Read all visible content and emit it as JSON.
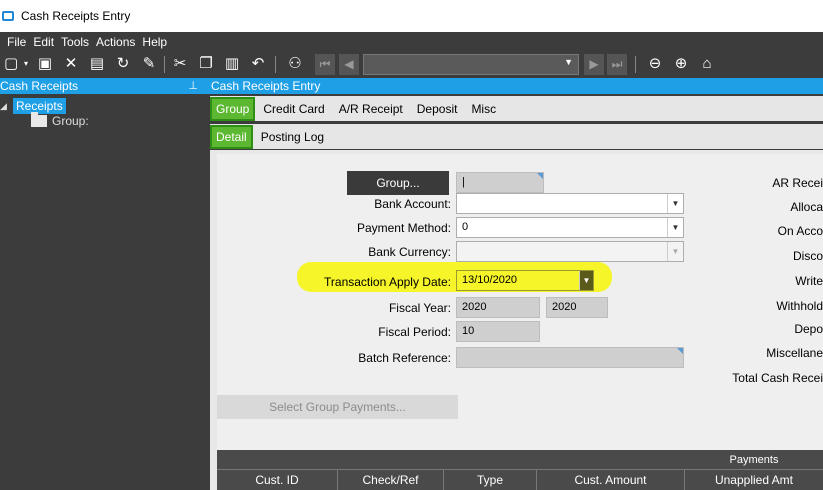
{
  "window": {
    "title": "Cash Receipts Entry"
  },
  "menu": [
    "File",
    "Edit",
    "Tools",
    "Actions",
    "Help"
  ],
  "toolbar": {
    "icons": [
      "new-icon",
      "save-icon",
      "delete-icon",
      "clipboard-icon",
      "refresh-icon",
      "clear-icon",
      "cut-icon",
      "copy-icon",
      "paste-icon",
      "undo-icon",
      "binoculars-icon",
      "first-icon",
      "prev-icon",
      "next-icon",
      "last-icon",
      "back-icon",
      "forward-icon",
      "home-icon"
    ]
  },
  "left_panel": {
    "title": "Cash Receipts",
    "tree": {
      "root": "Receipts",
      "child": "Group:"
    }
  },
  "main": {
    "title": "Cash Receipts Entry",
    "tabs": [
      "Group",
      "Credit Card",
      "A/R Receipt",
      "Deposit",
      "Misc"
    ],
    "subtabs": [
      "Detail",
      "Posting Log"
    ],
    "form": {
      "group_button": "Group...",
      "group_value": "|",
      "bank_account_label": "Bank Account:",
      "payment_method_label": "Payment Method:",
      "payment_method_value": "0",
      "bank_currency_label": "Bank Currency:",
      "transaction_apply_date_label": "Transaction Apply Date:",
      "transaction_apply_date_value": "13/10/2020",
      "fiscal_year_label": "Fiscal Year:",
      "fiscal_year_value": "2020",
      "fiscal_year_value2": "2020",
      "fiscal_period_label": "Fiscal Period:",
      "fiscal_period_value": "10",
      "batch_reference_label": "Batch Reference:",
      "select_group_payments": "Select Group Payments..."
    },
    "right_labels": [
      "AR Recei",
      "Alloca",
      "On Acco",
      "Disco",
      "Write",
      "Withhold",
      "Depo",
      "Miscellane",
      "Total Cash Recei"
    ],
    "grid": {
      "group_header": "Payments",
      "columns": [
        "Cust. ID",
        "Check/Ref",
        "Type",
        "Cust. Amount",
        "Unapplied Amt"
      ]
    }
  },
  "colors": {
    "accent": "#1e9fe6",
    "tab_active": "#5cb830",
    "highlight": "#f5f52a",
    "dark_bg": "#3c3c3c"
  }
}
